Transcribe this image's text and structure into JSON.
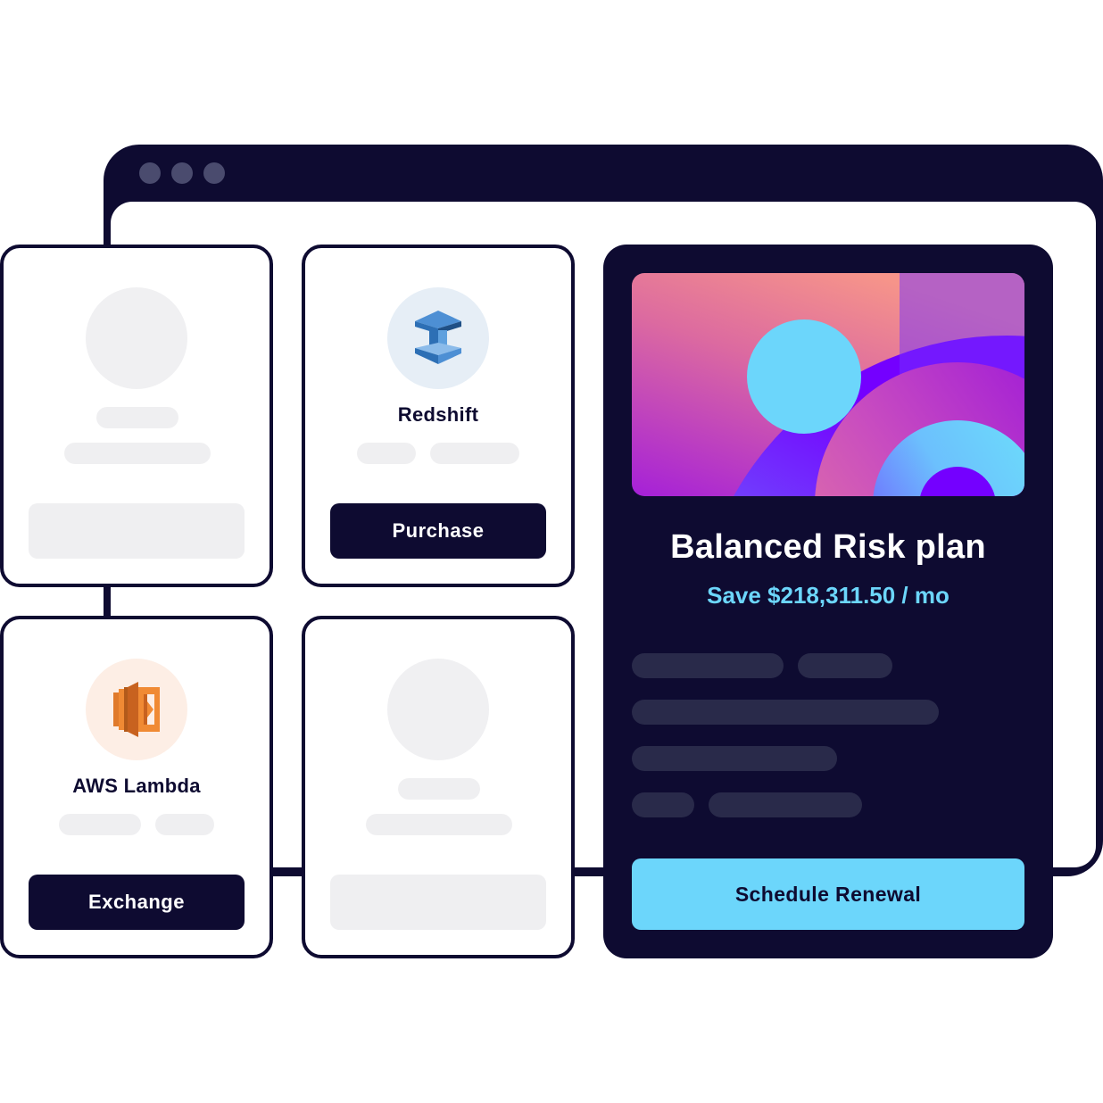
{
  "window": {
    "controls": [
      "dot-1",
      "dot-2",
      "dot-3"
    ]
  },
  "cards": {
    "placeholder_top_left": {},
    "redshift": {
      "title": "Redshift",
      "icon": "redshift-icon",
      "button_label": "Purchase"
    },
    "lambda": {
      "title": "AWS Lambda",
      "icon": "lambda-icon",
      "button_label": "Exchange"
    },
    "placeholder_bottom_middle": {}
  },
  "plan": {
    "title": "Balanced Risk plan",
    "savings": "Save $218,311.50 / mo",
    "button_label": "Schedule Renewal"
  },
  "colors": {
    "navy": "#0e0b31",
    "accent_cyan": "#6cd6fb",
    "placeholder_gray": "#efeff1",
    "dark_pill": "#292a4a"
  }
}
